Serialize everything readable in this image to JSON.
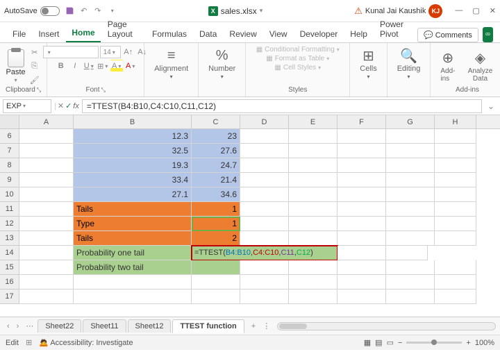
{
  "titlebar": {
    "autosave": "AutoSave",
    "filename": "sales.xlsx",
    "dropdown": "▾",
    "user": "Kunal Jai Kaushik",
    "initials": "KJ"
  },
  "tabs": {
    "items": [
      "File",
      "Insert",
      "Home",
      "Page Layout",
      "Formulas",
      "Data",
      "Review",
      "View",
      "Developer",
      "Help",
      "Power Pivot"
    ],
    "active": 2,
    "comments": "Comments"
  },
  "ribbon": {
    "clipboard": {
      "label": "Clipboard",
      "paste": "Paste"
    },
    "font": {
      "label": "Font",
      "name": "",
      "size": "14",
      "bold": "B",
      "italic": "I",
      "underline": "U"
    },
    "alignment": {
      "label": "Alignment",
      "btn": "Alignment"
    },
    "number": {
      "label": "Number",
      "btn": "Number",
      "symbol": "%"
    },
    "styles": {
      "label": "Styles",
      "cond": "Conditional Formatting",
      "table": "Format as Table",
      "cell": "Cell Styles"
    },
    "cells": {
      "label": "Cells",
      "btn": "Cells"
    },
    "editing": {
      "label": "Editing",
      "btn": "Editing"
    },
    "addins": {
      "label": "Add-ins",
      "addin": "Add-ins",
      "analyze": "Analyze Data"
    }
  },
  "namebox": "EXP",
  "formula": "=TTEST(B4:B10,C4:C10,C11,C12)",
  "cols": [
    "A",
    "B",
    "C",
    "D",
    "E",
    "F",
    "G",
    "H"
  ],
  "rowNums": [
    "6",
    "7",
    "8",
    "9",
    "10",
    "11",
    "12",
    "13",
    "14",
    "15",
    "16",
    "17"
  ],
  "data": {
    "b6": "12.3",
    "c6": "23",
    "b7": "32.5",
    "c7": "27.6",
    "b8": "19.3",
    "c8": "24.7",
    "b9": "33.4",
    "c9": "21.4",
    "b10": "27.1",
    "c10": "34.6",
    "b11": "Tails",
    "c11": "1",
    "b12": "Type",
    "c12": "1",
    "b13": "Tails",
    "c13": "2",
    "b14": "Probability one tail",
    "b15": "Probability two tail"
  },
  "formula_parts": {
    "pre": "=TTEST(",
    "a1": "B4:B10",
    "c1": ",",
    "a2": "C4:C10",
    "c2": ",",
    "a3": "C11",
    "c3": ",",
    "a4": "C12",
    "end": ")"
  },
  "sheets": {
    "items": [
      "Sheet22",
      "Sheet11",
      "Sheet12",
      "TTEST function"
    ],
    "active": 3,
    "add": "+",
    "more": "⋮"
  },
  "status": {
    "mode": "Edit",
    "access": "Accessibility: Investigate",
    "zoom": "100%"
  }
}
